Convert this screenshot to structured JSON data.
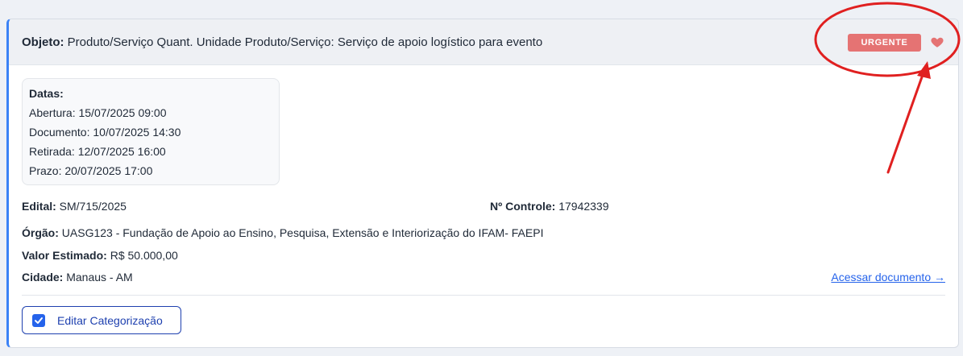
{
  "card": {
    "objeto_label": "Objeto:",
    "objeto_value": "Produto/Serviço Quant. Unidade Produto/Serviço: Serviço de apoio logístico para evento",
    "badge": "URGENTE",
    "favorite_icon": "heart-icon",
    "dates": {
      "title": "Datas:",
      "abertura_label": "Abertura:",
      "abertura_value": "15/07/2025 09:00",
      "documento_label": "Documento:",
      "documento_value": "10/07/2025 14:30",
      "retirada_label": "Retirada:",
      "retirada_value": "12/07/2025 16:00",
      "prazo_label": "Prazo:",
      "prazo_value": "20/07/2025 17:00"
    },
    "edital_label": "Edital:",
    "edital_value": "SM/715/2025",
    "controle_label": "Nº Controle:",
    "controle_value": "17942339",
    "orgao_label": "Órgão:",
    "orgao_value": "UASG123 - Fundação de Apoio ao Ensino, Pesquisa, Extensão e Interiorização do IFAM- FAEPI",
    "valor_label": "Valor Estimado:",
    "valor_value": "R$ 50.000,00",
    "cidade_label": "Cidade:",
    "cidade_value": "Manaus - AM",
    "document_link": "Acessar documento →",
    "edit_button": "Editar Categorização",
    "edit_checked": true
  },
  "colors": {
    "accent": "#3b82f6",
    "badge": "#e57373",
    "heart": "#e57373",
    "link": "#2563eb",
    "annotation": "#e02020"
  }
}
